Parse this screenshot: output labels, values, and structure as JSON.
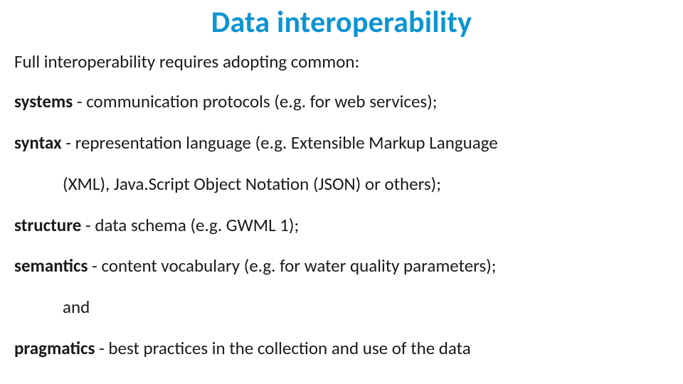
{
  "title": "Data interoperability",
  "introProse": "Full interoperability requires adopting common:",
  "items": {
    "systems": {
      "term": "systems",
      "rest": " - communication protocols (e.g. for web services);"
    },
    "syntax": {
      "term": "syntax",
      "rest": " - representation language (e.g. Extensible Markup Language",
      "cont": "(XML), Java.Script Object Notation (JSON) or others);"
    },
    "structure": {
      "term": "structure",
      "rest": " - data schema (e.g. GWML 1);"
    },
    "semantics": {
      "term": "semantics",
      "rest": " - content vocabulary (e.g. for water quality parameters);",
      "cont": "and"
    },
    "pragmatics": {
      "term": "pragmatics",
      "rest": " - best practices in the collection and use of the data"
    }
  }
}
